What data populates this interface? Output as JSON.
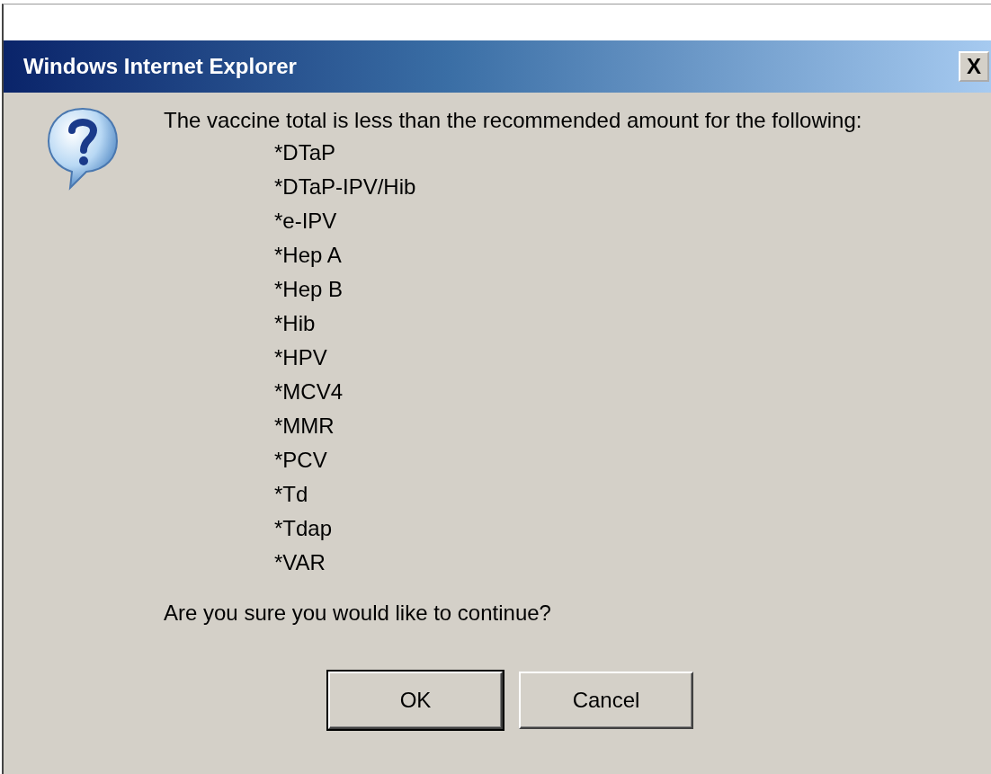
{
  "window": {
    "title": "Windows Internet Explorer",
    "close": "X"
  },
  "message": "The vaccine total is less than the recommended amount for the following:",
  "items": [
    "*DTaP",
    "*DTaP-IPV/Hib",
    "*e-IPV",
    "*Hep A",
    "*Hep B",
    "*Hib",
    "*HPV",
    "*MCV4",
    "*MMR",
    "*PCV",
    "*Td",
    "*Tdap",
    "*VAR"
  ],
  "question": "Are you sure you would like to continue?",
  "buttons": [
    {
      "label": "OK",
      "default": true
    },
    {
      "label": "Cancel",
      "default": false
    }
  ]
}
